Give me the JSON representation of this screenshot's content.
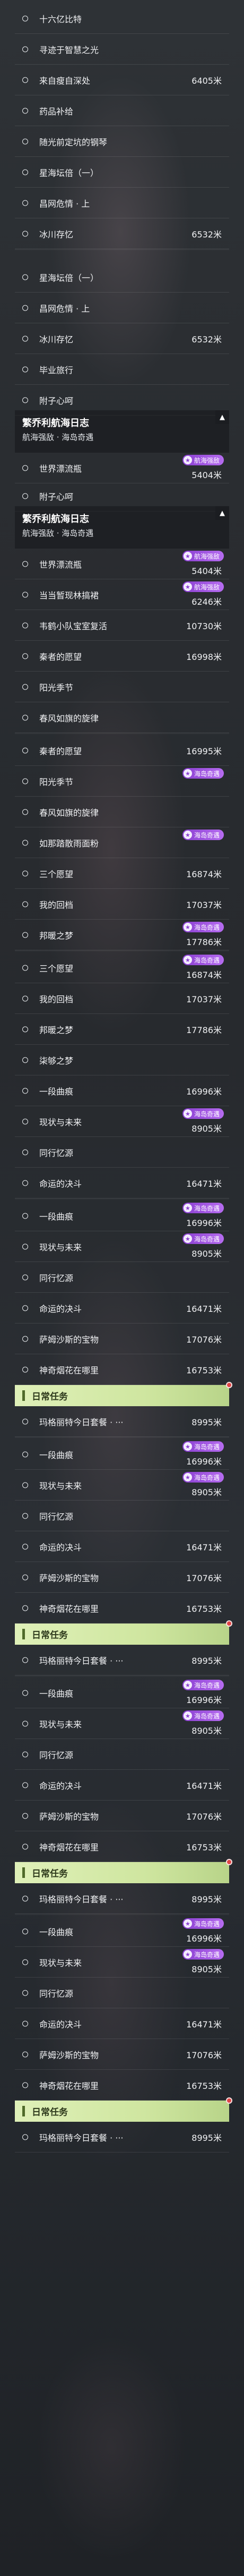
{
  "section_title": "繁乔利航海日志",
  "section_subtitle": "航海强敌 · 海岛奇遇",
  "badge_labels": {
    "nav": "航海强敌",
    "island": "海岛奇遇"
  },
  "daily_label": "日常任务",
  "icons": {
    "row_icon": "ring-icon",
    "badge_icon": "star-badge-icon",
    "collapse": "chevron-up-icon",
    "daily_alert": "red-dot-icon"
  },
  "colors": {
    "accent_purple": "#9b4ee0",
    "daily_green": "#d4eaa6",
    "alert_red": "#e04545"
  },
  "rows": [
    {
      "label": "十六亿比特",
      "distance": ""
    },
    {
      "label": "寻迹于智慧之光",
      "distance": ""
    },
    {
      "label": "来自瘦自深处",
      "distance": "6405米"
    },
    {
      "label": "药品补给",
      "distance": ""
    },
    {
      "label": "随光前定坑的钢琴",
      "distance": ""
    },
    {
      "label": "星海坛倍（一）",
      "distance": ""
    },
    {
      "label": "昌网危情 · 上",
      "distance": ""
    },
    {
      "label": "冰川存忆",
      "distance": "6532米"
    },
    {
      "label": "星海坛倍（一）",
      "distance": ""
    },
    {
      "label": "昌网危情 · 上",
      "distance": ""
    },
    {
      "label": "冰川存忆",
      "distance": "6532米"
    },
    {
      "label": "毕业旅行",
      "distance": ""
    },
    {
      "label": "附子心呵",
      "distance": ""
    },
    {
      "label": "世界漂流瓶",
      "distance": "5404米"
    },
    {
      "label": "附子心呵",
      "distance": ""
    },
    {
      "label": "世界漂流瓶",
      "distance": "5404米"
    },
    {
      "label": "当当暂现林搞裙",
      "distance": "6246米"
    },
    {
      "label": "韦鹤小队宝室复活",
      "distance": "10730米"
    },
    {
      "label": "秦者的愿望",
      "distance": "16998米"
    },
    {
      "label": "阳光季节",
      "distance": ""
    },
    {
      "label": "春风如旗的旋律",
      "distance": ""
    },
    {
      "label": "秦者的愿望",
      "distance": "16995米"
    },
    {
      "label": "阳光季节",
      "distance": ""
    },
    {
      "label": "春风如旗的旋律",
      "distance": ""
    },
    {
      "label": "如那踏散雨面粉",
      "distance": ""
    },
    {
      "label": "三个愿望",
      "distance": "16874米"
    },
    {
      "label": "我的回档",
      "distance": "17037米"
    },
    {
      "label": "邦暖之梦",
      "distance": "17786米"
    },
    {
      "label": "三个愿望",
      "distance": "16874米"
    },
    {
      "label": "我的回档",
      "distance": "17037米"
    },
    {
      "label": "邦暖之梦",
      "distance": "17786米"
    },
    {
      "label": "柒够之梦",
      "distance": ""
    },
    {
      "label": "一段曲痕",
      "distance": "16996米"
    },
    {
      "label": "现状与未来",
      "distance": "8905米"
    },
    {
      "label": "同行忆源",
      "distance": ""
    },
    {
      "label": "命运的决斗",
      "distance": "16471米"
    },
    {
      "label": "一段曲痕",
      "distance": "16996米"
    },
    {
      "label": "现状与未来",
      "distance": "8905米"
    },
    {
      "label": "同行忆源",
      "distance": ""
    },
    {
      "label": "命运的决斗",
      "distance": "16471米"
    },
    {
      "label": "萨姆沙斯的宝物",
      "distance": "17076米"
    },
    {
      "label": "神奇烟花在哪里",
      "distance": "16753米"
    },
    {
      "label": "玛格丽特今日套餐 · ···",
      "distance": "8995米"
    },
    {
      "label": "一段曲痕",
      "distance": "16996米"
    },
    {
      "label": "现状与未来",
      "distance": "8905米"
    },
    {
      "label": "同行忆源",
      "distance": ""
    },
    {
      "label": "命运的决斗",
      "distance": "16471米"
    },
    {
      "label": "萨姆沙斯的宝物",
      "distance": "17076米"
    },
    {
      "label": "神奇烟花在哪里",
      "distance": "16753米"
    },
    {
      "label": "玛格丽特今日套餐 · ···",
      "distance": "8995米"
    },
    {
      "label": "一段曲痕",
      "distance": "16996米"
    },
    {
      "label": "现状与未来",
      "distance": "8905米"
    },
    {
      "label": "同行忆源",
      "distance": ""
    },
    {
      "label": "命运的决斗",
      "distance": "16471米"
    },
    {
      "label": "萨姆沙斯的宝物",
      "distance": "17076米"
    },
    {
      "label": "神奇烟花在哪里",
      "distance": "16753米"
    },
    {
      "label": "玛格丽特今日套餐 · ···",
      "distance": "8995米"
    },
    {
      "label": "一段曲痕",
      "distance": "16996米"
    },
    {
      "label": "现状与未来",
      "distance": "8905米"
    },
    {
      "label": "同行忆源",
      "distance": ""
    },
    {
      "label": "命运的决斗",
      "distance": "16471米"
    },
    {
      "label": "萨姆沙斯的宝物",
      "distance": "17076米"
    },
    {
      "label": "神奇烟花在哪里",
      "distance": "16753米"
    },
    {
      "label": "玛格丽特今日套餐 · ···",
      "distance": "8995米"
    }
  ]
}
